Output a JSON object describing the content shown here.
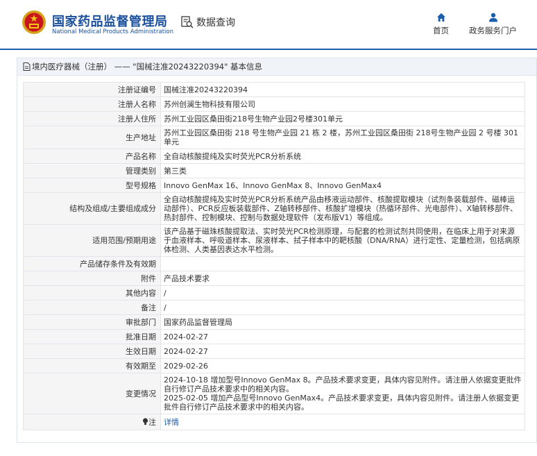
{
  "header": {
    "title_cn": "国家药品监督管理局",
    "title_en": "National Medical Products Administration",
    "data_query": "数据查询",
    "nav": [
      {
        "label": "首页",
        "icon": "home-icon"
      },
      {
        "label": "政务服务门户",
        "icon": "user-icon"
      }
    ],
    "colors": {
      "brand": "#1a4f9c",
      "accent": "#1a5dab"
    }
  },
  "panel": {
    "breadcrumb": "境内医疗器械（注册） —— \"国械注准20243220394\" 基本信息"
  },
  "rows": [
    {
      "label": "注册证编号",
      "value": "国械注准20243220394"
    },
    {
      "label": "注册人名称",
      "value": "苏州创澜生物科技有限公司"
    },
    {
      "label": "注册人住所",
      "value": "苏州工业园区桑田街218号生物产业园2号楼301单元"
    },
    {
      "label": "生产地址",
      "value": "苏州工业园区桑田街 218 号生物产业园 21 栋 2 楼，苏州工业园区桑田街 218号生物产业园 2 号楼 301 单元"
    },
    {
      "label": "产品名称",
      "value": "全自动核酸提纯及实时荧光PCR分析系统"
    },
    {
      "label": "管理类别",
      "value": "第三类"
    },
    {
      "label": "型号规格",
      "value": "Innovo GenMax 16、Innovo GenMax 8、Innovo GenMax4"
    },
    {
      "label": "结构及组成/主要组成成分",
      "value": "全自动核酸提纯及实时荧光PCR分析系统产品由移液运动部件、核酸提取模块（试剂条装载部件、磁棒运动部件）、PCR反应板装载部件、Z轴转移部件、核酸扩增模块（热循环部件、光电部件）、X轴转移部件、热封部件、控制模块、控制与数据处理软件（发布版V1）等组成。"
    },
    {
      "label": "适用范围/预期用途",
      "value": "该产品基于磁珠核酸提取法、实时荧光PCR检测原理，与配套的检测试剂共同使用，在临床上用于对来源于血液样本、呼吸道样本、尿液样本、拭子样本中的靶核酸（DNA/RNA）进行定性、定量检测，包括病原体检测、人类基因表达水平检测。"
    },
    {
      "label": "产品储存条件及有效期",
      "value": ""
    },
    {
      "label": "附件",
      "value": "产品技术要求"
    },
    {
      "label": "其他内容",
      "value": "/"
    },
    {
      "label": "备注",
      "value": "/"
    },
    {
      "label": "审批部门",
      "value": "国家药品监督管理局"
    },
    {
      "label": "批准日期",
      "value": "2024-02-27"
    },
    {
      "label": "生效日期",
      "value": "2024-02-27"
    },
    {
      "label": "有效期至",
      "value": "2029-02-26"
    },
    {
      "label": "变更情况",
      "value": "2024-10-18 增加型号Innovo GenMax 8。产品技术要求变更，具体内容见附件。请注册人依据变更批件自行修订产品技术要求中的相关内容。\n2025-02-05 增加产品型号Innovo GenMax4。产品技术要求变更，具体内容见附件。请注册人依据变更批件自行修订产品技术要求中的相关内容。"
    }
  ],
  "note": {
    "label": "注",
    "link": "详情",
    "icon": "bulb-icon"
  }
}
